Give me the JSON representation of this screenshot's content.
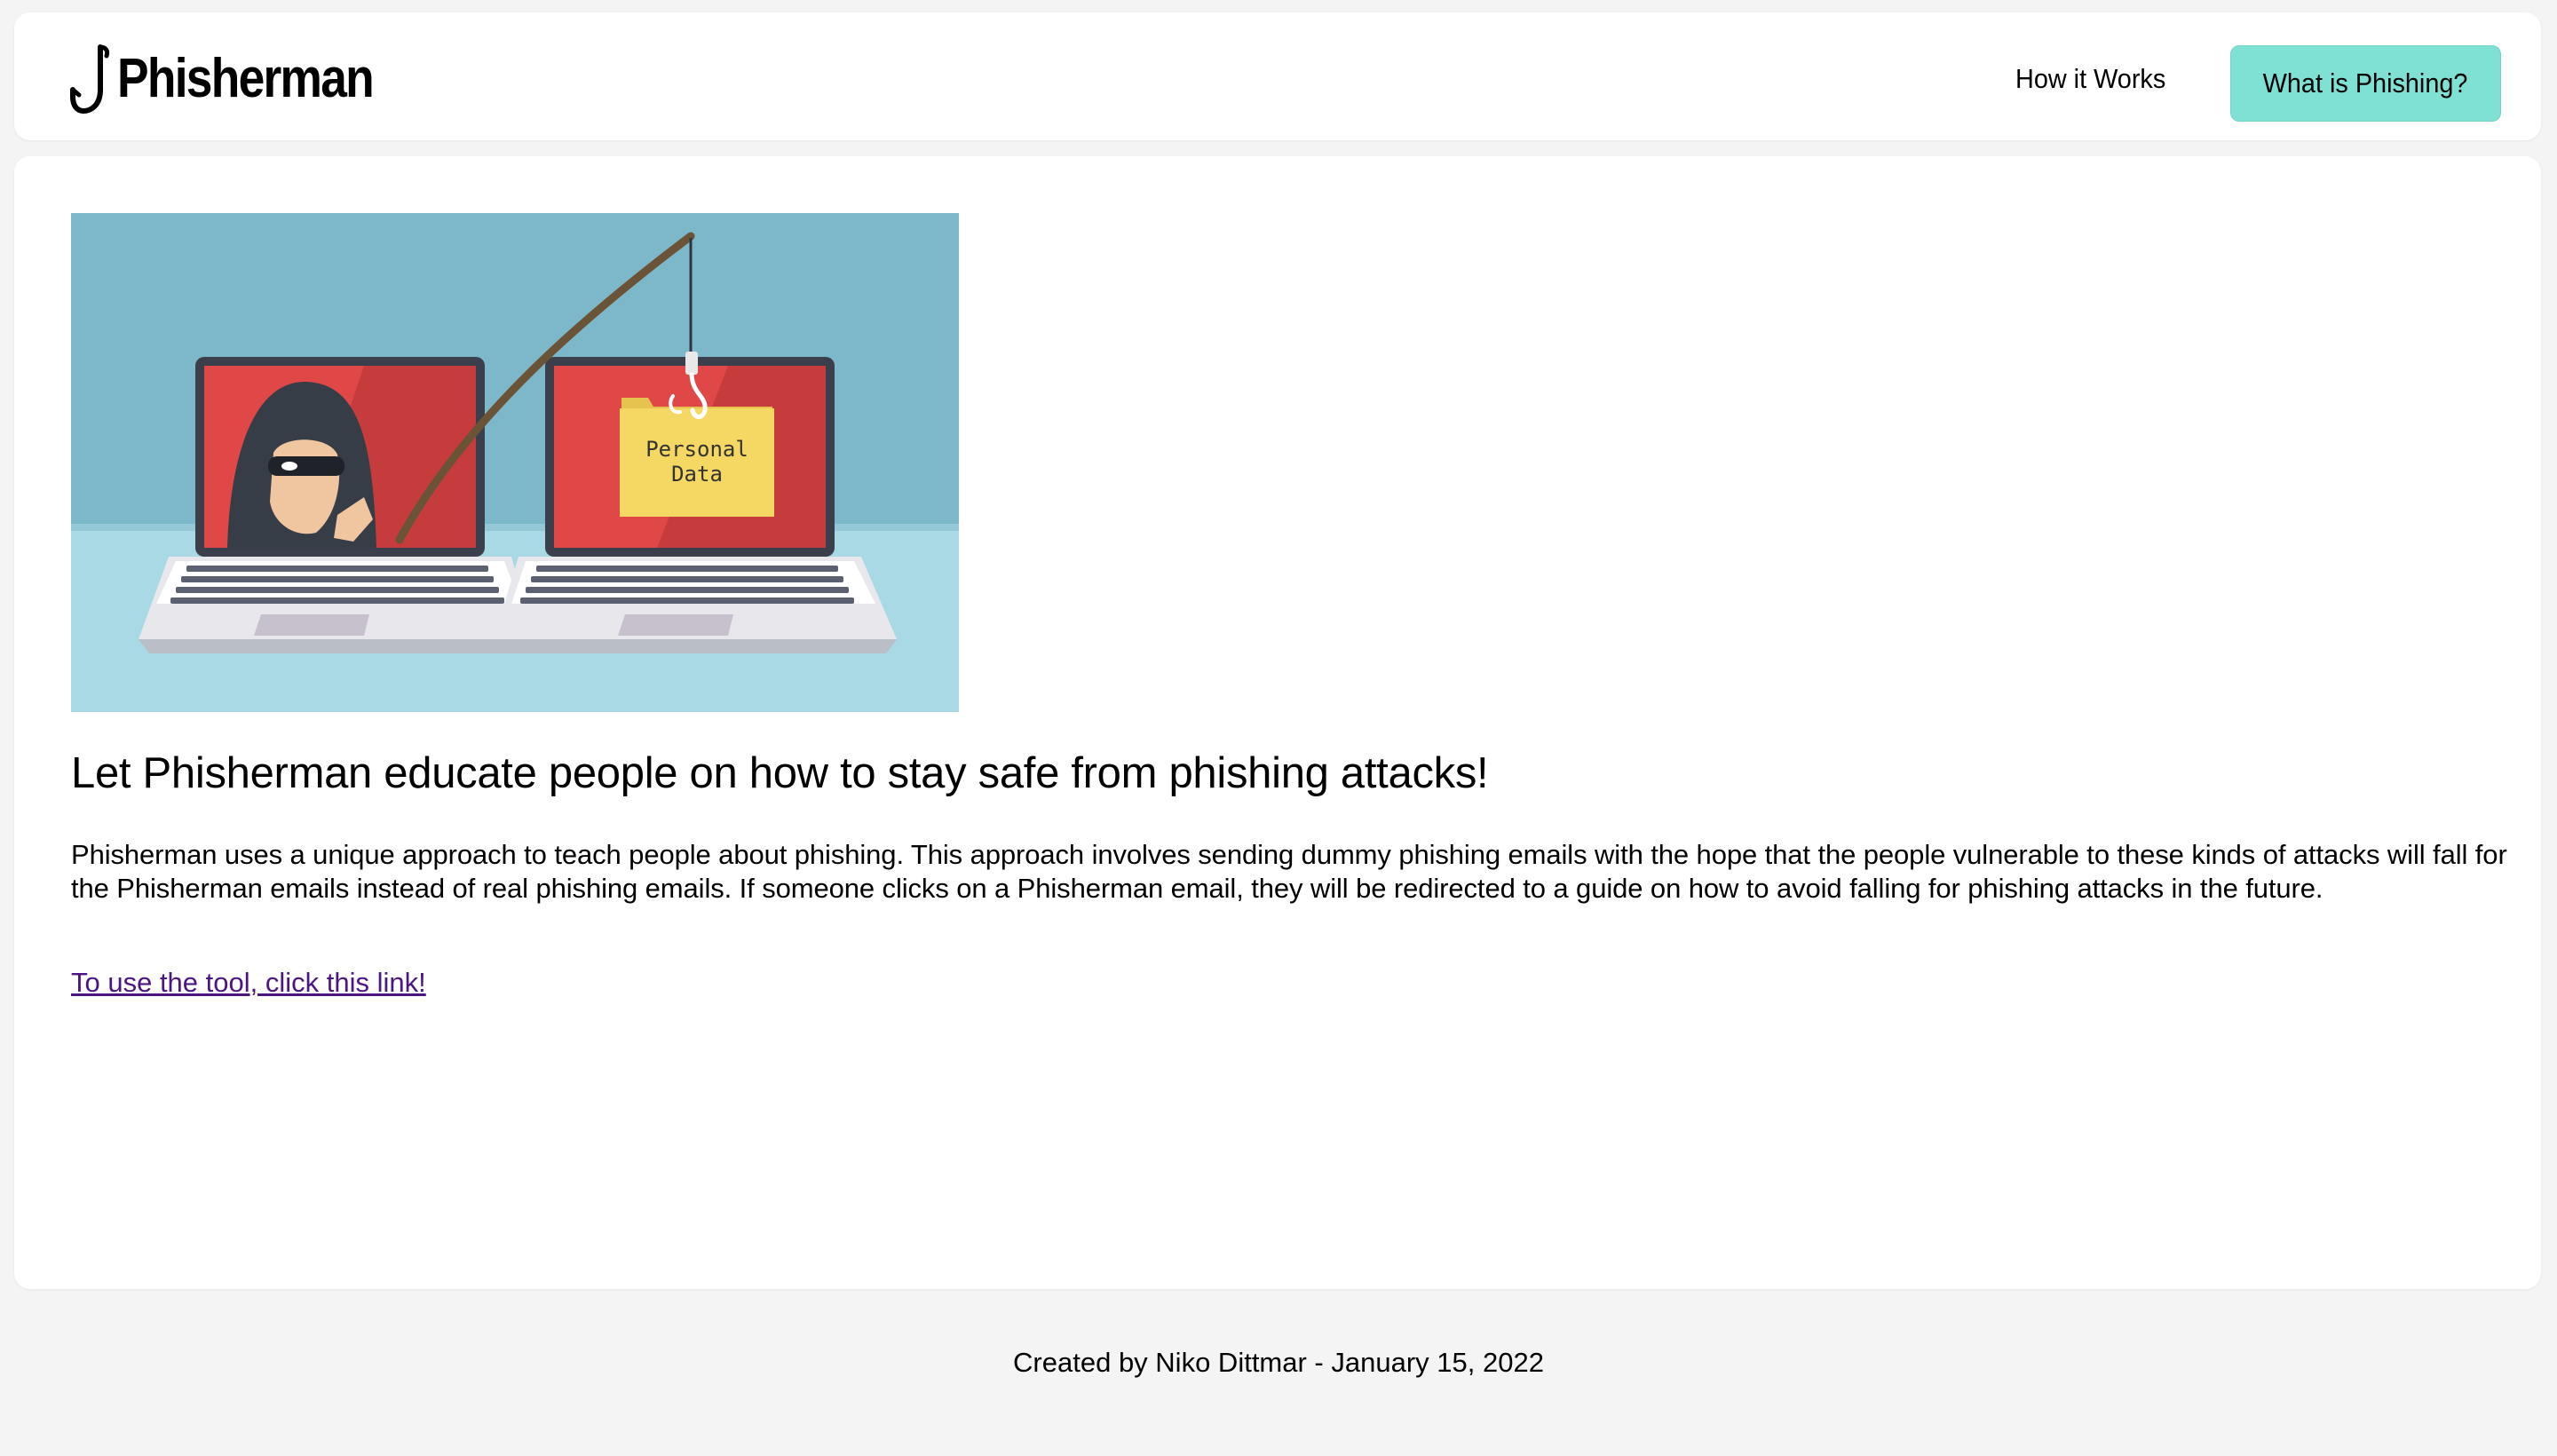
{
  "header": {
    "brand_name": "Phisherman",
    "nav_link_label": "How it Works",
    "nav_button_label": "What is Phishing?"
  },
  "hero": {
    "folder_line_1": "Personal",
    "folder_line_2": "Data"
  },
  "main": {
    "headline": "Let Phisherman educate people on how to stay safe from phishing attacks!",
    "description": "Phisherman uses a unique approach to teach people about phishing. This approach involves sending dummy phishing emails with the hope that the people vulnerable to these kinds of attacks will fall for the Phisherman emails instead of real phishing emails. If someone clicks on a Phisherman email, they will be redirected to a guide on how to avoid falling for phishing attacks in the future.",
    "tool_link": "To use the tool, click this link!"
  },
  "footer": {
    "credit": "Created by Niko Dittmar - January 15, 2022"
  },
  "colors": {
    "page_background": "#f4f4f4",
    "card_background": "#ffffff",
    "accent_button": "#7ee1d3",
    "link": "#4b1680",
    "hero_sky": "#7cb8ca",
    "hero_desk": "#a9d9e5",
    "screen_red": "#e04848",
    "folder_yellow": "#f5d864"
  },
  "icons": {
    "logo": "fish-hook-icon"
  }
}
